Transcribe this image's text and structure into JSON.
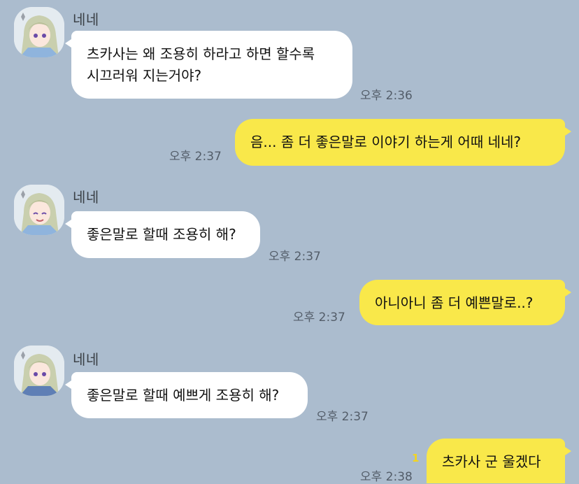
{
  "colors": {
    "background": "#abbcce",
    "incoming_bubble": "#ffffff",
    "outgoing_bubble": "#f9e84a",
    "timestamp": "#535d69",
    "unread": "#f3d41d"
  },
  "messages": [
    {
      "direction": "in",
      "sender": "네네",
      "avatar_icon": "profile-avatar-icon",
      "lines": [
        "츠카사는 왜 조용히 하라고 하면 할수록",
        "시끄러워 지는거야?"
      ],
      "time": "오후 2:36"
    },
    {
      "direction": "out",
      "lines": [
        "음... 좀 더 좋은말로 이야기 하는게 어때 네네?"
      ],
      "time": "오후 2:37"
    },
    {
      "direction": "in",
      "sender": "네네",
      "avatar_icon": "profile-avatar-icon",
      "lines": [
        "좋은말로 할때 조용히 해?"
      ],
      "time": "오후 2:37"
    },
    {
      "direction": "out",
      "lines": [
        "아니아니 좀 더 예쁜말로..?"
      ],
      "time": "오후 2:37"
    },
    {
      "direction": "in",
      "sender": "네네",
      "avatar_icon": "profile-avatar-icon",
      "lines": [
        "좋은말로 할때 예쁘게 조용히 해?"
      ],
      "time": "오후 2:37"
    },
    {
      "direction": "out",
      "lines": [
        "츠카사 군 울겠다"
      ],
      "time": "오후 2:38",
      "unread": "1"
    }
  ]
}
